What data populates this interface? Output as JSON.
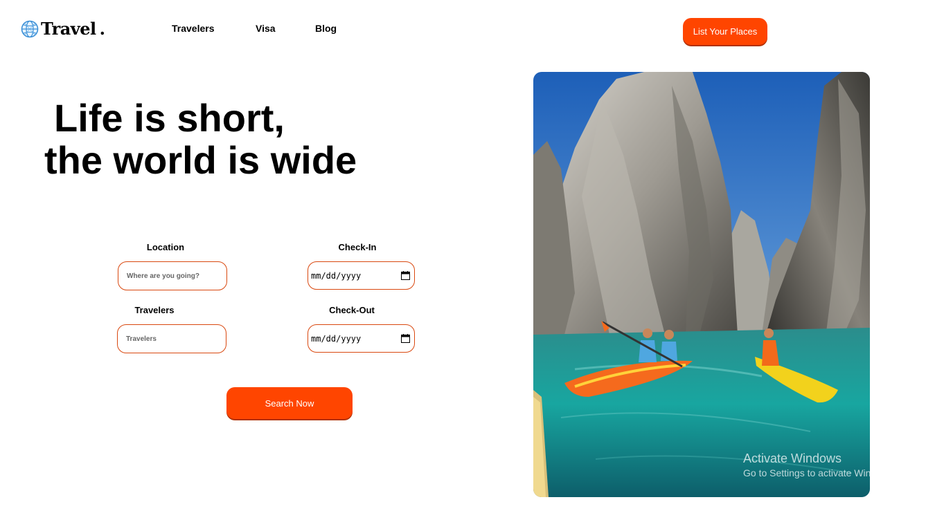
{
  "brand": {
    "name": "Travel",
    "dot": ".",
    "icon": "globe-icon"
  },
  "nav": {
    "travelers": "Travelers",
    "visa": "Visa",
    "blog": "Blog"
  },
  "header": {
    "cta_label": "List Your Places"
  },
  "hero": {
    "line1": "Life is short,",
    "line2": "the world is wide"
  },
  "form": {
    "location": {
      "label": "Location",
      "placeholder": "Where are you going?"
    },
    "checkin": {
      "label": "Check-In",
      "value": "mm/dd/yyyy"
    },
    "travelers": {
      "label": "Travelers",
      "placeholder": "Travelers"
    },
    "checkout": {
      "label": "Check-Out",
      "value": "mm/dd/yyyy"
    },
    "search_label": "Search Now"
  },
  "watermark": {
    "title": "Activate Windows",
    "subtitle": "Go to Settings to activate Windows."
  },
  "colors": {
    "accent": "#ff4500",
    "input_border": "#d9480f",
    "text": "#000000"
  }
}
